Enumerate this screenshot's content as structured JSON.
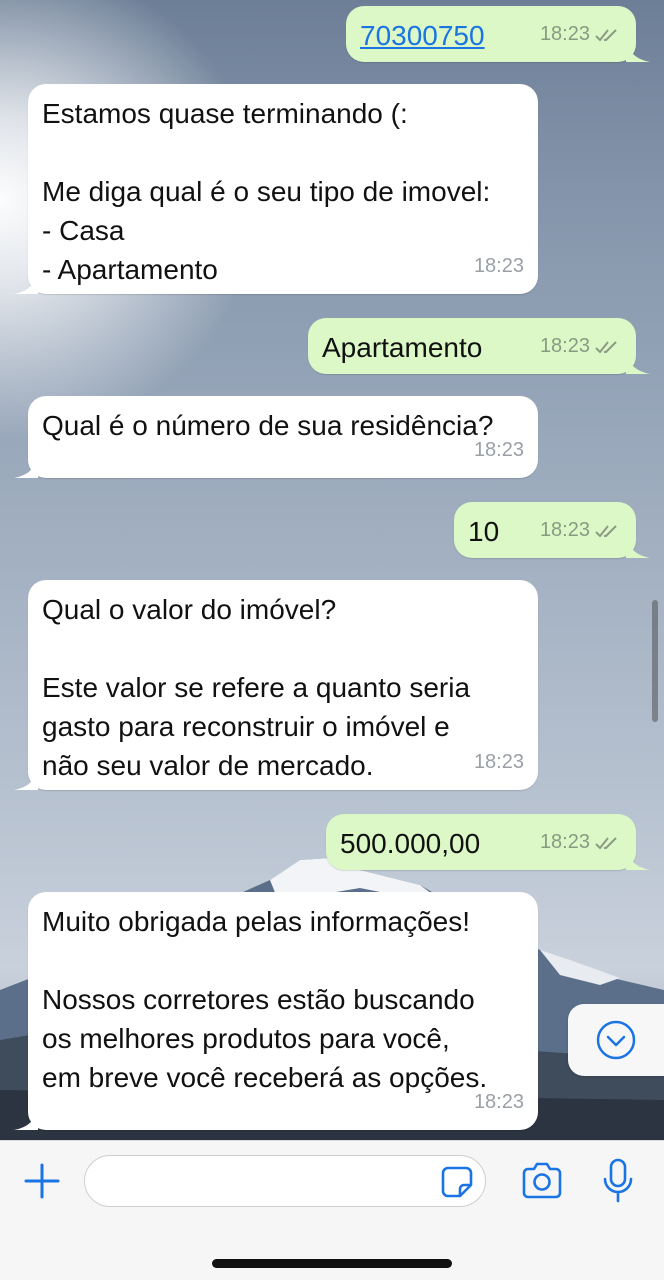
{
  "messages": [
    {
      "dir": "out",
      "text": "70300750",
      "time": "18:23",
      "is_link": true
    },
    {
      "dir": "in",
      "text": "Estamos quase terminando (:\n\nMe diga qual é o seu tipo de imovel:\n- Casa\n- Apartamento",
      "time": "18:23"
    },
    {
      "dir": "out",
      "text": "Apartamento",
      "time": "18:23"
    },
    {
      "dir": "in",
      "text": "Qual é o número de sua residência?",
      "time": "18:23"
    },
    {
      "dir": "out",
      "text": "10",
      "time": "18:23"
    },
    {
      "dir": "in",
      "text": "Qual o valor do imóvel?\n\nEste valor se refere a quanto seria\ngasto para reconstruir o imóvel e\nnão seu valor de mercado.",
      "time": "18:23"
    },
    {
      "dir": "out",
      "text": "500.000,00",
      "time": "18:23"
    },
    {
      "dir": "in",
      "text": "Muito obrigada pelas informações!\n\nNossos corretores estão buscando\nos melhores produtos para você,\nem breve você receberá as opções.",
      "time": "18:23"
    }
  ],
  "input": {
    "value": "",
    "placeholder": ""
  },
  "icons": {
    "read_receipt": "double-check-icon",
    "attach": "plus-icon",
    "sticker": "sticker-icon",
    "camera": "camera-icon",
    "mic": "microphone-icon",
    "scroll_down": "chevron-down-circle-icon"
  },
  "colors": {
    "accent": "#1b74e4",
    "outgoing_bubble": "#dcf8c6",
    "incoming_bubble": "#ffffff"
  }
}
